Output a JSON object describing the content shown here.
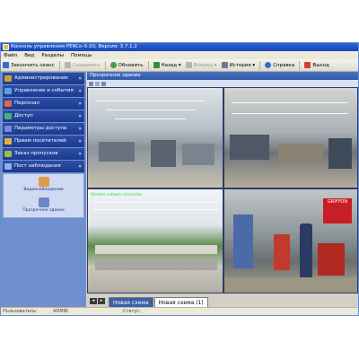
{
  "window": {
    "title": "Консоль управления PERCo-S-20, Версия: 3.7.1.2"
  },
  "menu": [
    "Файл",
    "Вид",
    "Разделы",
    "Помощь"
  ],
  "toolbar": {
    "finish_session": "Закончить сеанс",
    "save": "Сохранить",
    "refresh": "Обновить",
    "back": "Назад",
    "forward": "Вперед",
    "history": "История",
    "help": "Справка",
    "exit": "Выход"
  },
  "sidebar": {
    "items": [
      {
        "label": "Администрирование",
        "icon": "admin-icon",
        "color": "#c9a03a"
      },
      {
        "label": "Управление и события",
        "icon": "events-icon",
        "color": "#5aa0e0"
      },
      {
        "label": "Персонал",
        "icon": "personnel-icon",
        "color": "#d86a4a"
      },
      {
        "label": "Доступ",
        "icon": "access-icon",
        "color": "#4ab07a"
      },
      {
        "label": "Параметры доступа",
        "icon": "access-params-icon",
        "color": "#7a8ad8"
      },
      {
        "label": "Прием посетителей",
        "icon": "visitors-icon",
        "color": "#e0b040"
      },
      {
        "label": "Заказ пропусков",
        "icon": "pass-order-icon",
        "color": "#9ac04a"
      },
      {
        "label": "Пост наблюдения",
        "icon": "monitoring-post-icon",
        "color": "#8fb0e8"
      }
    ],
    "subitems": [
      {
        "label": "Видеонаблюдение",
        "icon": "video-surveillance-icon",
        "color": "#e09a50"
      },
      {
        "label": "Прозрачное здание",
        "icon": "transparent-building-icon",
        "color": "#6a88c8"
      }
    ]
  },
  "main": {
    "header": "Прозрачное здание",
    "camera_overlay": "Wireless network connection",
    "wall_banner": "GRIFFON",
    "tabs": [
      {
        "label": "Новая схема",
        "active": false
      },
      {
        "label": "Новая схема (1)",
        "active": true
      }
    ]
  },
  "statusbar": {
    "user_label": "Пользователь:",
    "user_value": "ADMIN",
    "status_label": "Статус:"
  },
  "colors": {
    "title_blue": "#1844b4",
    "sidebar_blue": "#6f8fce",
    "banner_red": "#c81e28"
  }
}
